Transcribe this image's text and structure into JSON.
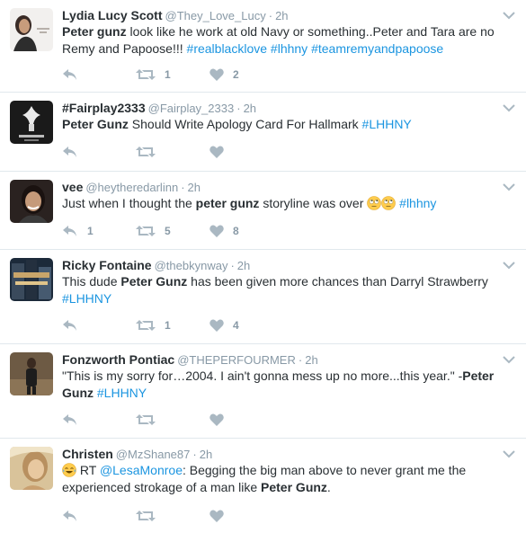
{
  "tweets": [
    {
      "name": "Lydia Lucy Scott",
      "handle": "@They_Love_Lucy",
      "time": "2h",
      "parts": [
        {
          "t": "Peter gunz",
          "s": "b"
        },
        {
          "t": " look like he work at old Navy or something..Peter and Tara are no Remy and Papoose!!! ",
          "s": "n"
        },
        {
          "t": "#realblacklove",
          "s": "tag"
        },
        {
          "t": " ",
          "s": "n"
        },
        {
          "t": "#lhhny",
          "s": "tag"
        },
        {
          "t": " ",
          "s": "n"
        },
        {
          "t": "#teamremyandpapoose",
          "s": "tag"
        }
      ],
      "retweets": "1",
      "likes": "2"
    },
    {
      "name": "#Fairplay2333",
      "handle": "@Fairplay_2333",
      "time": "2h",
      "parts": [
        {
          "t": "Peter Gunz",
          "s": "b"
        },
        {
          "t": " Should Write Apology Card For Hallmark ",
          "s": "n"
        },
        {
          "t": "#LHHNY",
          "s": "tag"
        }
      ],
      "retweets": "",
      "likes": ""
    },
    {
      "name": "vee",
      "handle": "@heytheredarlinn",
      "time": "2h",
      "parts": [
        {
          "t": "Just when I thought the ",
          "s": "n"
        },
        {
          "t": "peter gunz",
          "s": "b"
        },
        {
          "t": " storyline was over ",
          "s": "n"
        },
        {
          "t": "rolling-eyes-emoji",
          "s": "emoji"
        },
        {
          "t": "rolling-eyes-emoji",
          "s": "emoji"
        },
        {
          "t": " ",
          "s": "n"
        },
        {
          "t": "#lhhny",
          "s": "tag"
        }
      ],
      "replies": "1",
      "retweets": "5",
      "likes": "8"
    },
    {
      "name": "Ricky Fontaine",
      "handle": "@thebkynway",
      "time": "2h",
      "parts": [
        {
          "t": "This dude ",
          "s": "n"
        },
        {
          "t": "Peter Gunz",
          "s": "b"
        },
        {
          "t": " has been given more chances than Darryl Strawberry ",
          "s": "n"
        },
        {
          "t": "#LHHNY",
          "s": "tag"
        }
      ],
      "retweets": "1",
      "likes": "4"
    },
    {
      "name": "Fonzworth Pontiac",
      "handle": "@THEPERFOURMER",
      "time": "2h",
      "parts": [
        {
          "t": "\"This is my sorry for…2004. I ain't gonna mess up no more...this year.\" -",
          "s": "n"
        },
        {
          "t": "Peter Gunz",
          "s": "b"
        },
        {
          "t": " ",
          "s": "n"
        },
        {
          "t": "#LHHNY",
          "s": "tag"
        }
      ],
      "retweets": "",
      "likes": ""
    },
    {
      "name": "Christen",
      "handle": "@MzShane87",
      "time": "2h",
      "parts": [
        {
          "t": "tears-of-joy-emoji",
          "s": "emoji"
        },
        {
          "t": " RT ",
          "s": "n"
        },
        {
          "t": "@LesaMonroe",
          "s": "tag"
        },
        {
          "t": ": Begging the big man above to never grant me the experienced strokage of a man like ",
          "s": "n"
        },
        {
          "t": "Peter Gunz",
          "s": "b"
        },
        {
          "t": ".",
          "s": "n"
        }
      ],
      "retweets": "",
      "likes": ""
    }
  ],
  "colors": {
    "link": "#1b95e0",
    "muted": "#8899a6",
    "icon": "#aab8c2",
    "divider": "#e1e8ed"
  }
}
